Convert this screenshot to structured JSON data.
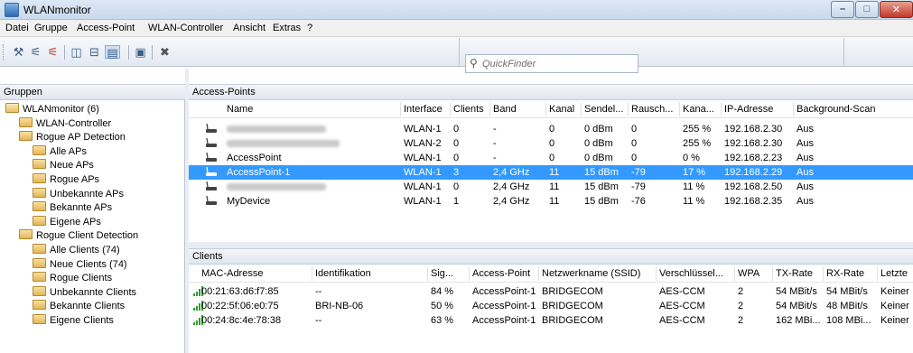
{
  "window": {
    "title": "WLANmonitor"
  },
  "menu": [
    "Datei",
    "Gruppe",
    "Access-Point",
    "WLAN-Controller",
    "Ansicht",
    "Extras",
    "?"
  ],
  "toolbar": {
    "icons": [
      "tools-icon",
      "antenna-icon",
      "antenna-red-icon",
      "split-vertical-icon",
      "split-horizontal-icon",
      "list-view-icon",
      "window-icon",
      "close-x-icon"
    ],
    "quickfinder_placeholder": "QuickFinder"
  },
  "groups": {
    "header": "Gruppen",
    "items": [
      {
        "label": "WLANmonitor (6)",
        "level": 0
      },
      {
        "label": "WLAN-Controller",
        "level": 1
      },
      {
        "label": "Rogue AP Detection",
        "level": 1
      },
      {
        "label": "Alle APs",
        "level": 2
      },
      {
        "label": "Neue APs",
        "level": 2
      },
      {
        "label": "Rogue APs",
        "level": 2
      },
      {
        "label": "Unbekannte APs",
        "level": 2
      },
      {
        "label": "Bekannte APs",
        "level": 2
      },
      {
        "label": "Eigene APs",
        "level": 2
      },
      {
        "label": "Rogue Client Detection",
        "level": 1
      },
      {
        "label": "Alle Clients (74)",
        "level": 2
      },
      {
        "label": "Neue Clients (74)",
        "level": 2
      },
      {
        "label": "Rogue Clients",
        "level": 2
      },
      {
        "label": "Unbekannte Clients",
        "level": 2
      },
      {
        "label": "Bekannte Clients",
        "level": 2
      },
      {
        "label": "Eigene Clients",
        "level": 2
      }
    ]
  },
  "access_points": {
    "header": "Access-Points",
    "columns": [
      "Name",
      "Interface",
      "Clients",
      "Band",
      "Kanal",
      "Sendel...",
      "Rausch...",
      "Kana...",
      "IP-Adresse",
      "Background-Scan"
    ],
    "rows": [
      {
        "name": "",
        "blurred": true,
        "interface": "WLAN-1",
        "clients": "0",
        "band": "-",
        "kanal": "0",
        "sendel": "0 dBm",
        "rausch": "0",
        "kana": "255 %",
        "ip": "192.168.2.30",
        "scan": "Aus"
      },
      {
        "name": "",
        "blurred": true,
        "interface": "WLAN-2",
        "clients": "0",
        "band": "-",
        "kanal": "0",
        "sendel": "0 dBm",
        "rausch": "0",
        "kana": "255 %",
        "ip": "192.168.2.30",
        "scan": "Aus"
      },
      {
        "name": "AccessPoint",
        "blurred": false,
        "interface": "WLAN-1",
        "clients": "0",
        "band": "-",
        "kanal": "0",
        "sendel": "0 dBm",
        "rausch": "0",
        "kana": "0 %",
        "ip": "192.168.2.23",
        "scan": "Aus"
      },
      {
        "name": "AccessPoint-1",
        "blurred": false,
        "selected": true,
        "interface": "WLAN-1",
        "clients": "3",
        "band": "2,4 GHz",
        "kanal": "11",
        "sendel": "15 dBm",
        "rausch": "-79",
        "kana": "17 %",
        "ip": "192.168.2.29",
        "scan": "Aus"
      },
      {
        "name": "",
        "blurred": true,
        "interface": "WLAN-1",
        "clients": "0",
        "band": "2,4 GHz",
        "kanal": "11",
        "sendel": "15 dBm",
        "rausch": "-79",
        "kana": "11 %",
        "ip": "192.168.2.50",
        "scan": "Aus"
      },
      {
        "name": "MyDevice",
        "blurred": false,
        "interface": "WLAN-1",
        "clients": "1",
        "band": "2,4 GHz",
        "kanal": "11",
        "sendel": "15 dBm",
        "rausch": "-76",
        "kana": "11 %",
        "ip": "192.168.2.35",
        "scan": "Aus"
      }
    ]
  },
  "clients": {
    "header": "Clients",
    "columns": [
      "MAC-Adresse",
      "Identifikation",
      "Sig...",
      "Access-Point",
      "Netzwerkname (SSID)",
      "Verschlüssel...",
      "WPA",
      "TX-Rate",
      "RX-Rate",
      "Letzte"
    ],
    "rows": [
      {
        "mac": "00:21:63:d6:f7:85",
        "ident": "--",
        "sig": "84 %",
        "ap": "AccessPoint-1",
        "ssid": "BRIDGECOM",
        "enc": "AES-CCM",
        "wpa": "2",
        "tx": "54 MBit/s",
        "rx": "54 MBit/s",
        "last": "Keiner"
      },
      {
        "mac": "00:22:5f:06:e0:75",
        "ident": "BRI-NB-06",
        "sig": "50 %",
        "ap": "AccessPoint-1",
        "ssid": "BRIDGECOM",
        "enc": "AES-CCM",
        "wpa": "2",
        "tx": "54 MBit/s",
        "rx": "48 MBit/s",
        "last": "Keiner"
      },
      {
        "mac": "00:24:8c:4e:78:38",
        "ident": "--",
        "sig": "63 %",
        "ap": "AccessPoint-1",
        "ssid": "BRIDGECOM",
        "enc": "AES-CCM",
        "wpa": "2",
        "tx": "162 MBi...",
        "rx": "108 MBi...",
        "last": "Keiner"
      }
    ]
  },
  "colors": {
    "selection": "#3399ff",
    "signal": "#2e9e2e"
  }
}
